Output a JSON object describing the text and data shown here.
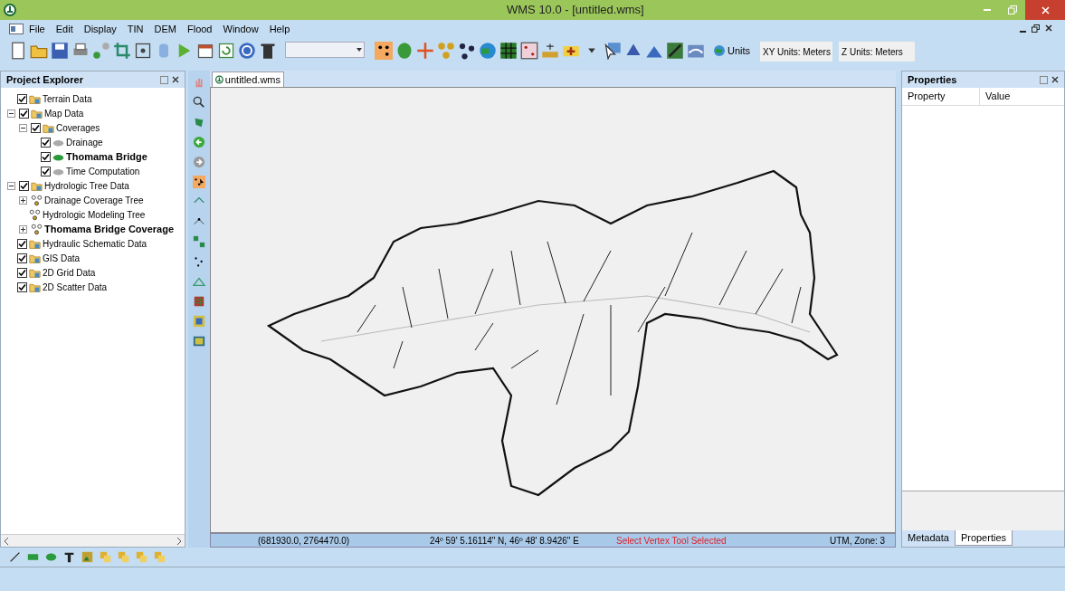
{
  "window": {
    "title": "WMS 10.0 - [untitled.wms]"
  },
  "menu": [
    "File",
    "Edit",
    "Display",
    "TIN",
    "DEM",
    "Flood",
    "Window",
    "Help"
  ],
  "units": {
    "button": "Units",
    "xy": "XY Units: Meters",
    "z": "Z Units: Meters"
  },
  "project_explorer": {
    "title": "Project Explorer",
    "items": [
      {
        "label": "Terrain Data",
        "kind": "folder",
        "checked": true,
        "active": false
      },
      {
        "label": "Map Data",
        "kind": "folder",
        "checked": true,
        "active": false,
        "expanded": true,
        "children": [
          {
            "label": "Coverages",
            "kind": "folder",
            "checked": true,
            "active": false,
            "expanded": true,
            "children": [
              {
                "label": "Drainage",
                "kind": "coverage",
                "checked": true,
                "active": false
              },
              {
                "label": "Thomama Bridge",
                "kind": "coverage",
                "checked": true,
                "active": true
              },
              {
                "label": "Time Computation",
                "kind": "coverage",
                "checked": true,
                "active": false
              }
            ]
          }
        ]
      },
      {
        "label": "Hydrologic Tree Data",
        "kind": "folder",
        "checked": true,
        "active": false,
        "expanded": true,
        "children": [
          {
            "label": "Drainage Coverage Tree",
            "kind": "tree",
            "active": false,
            "expanded": false
          },
          {
            "label": "Hydrologic Modeling Tree",
            "kind": "tree",
            "active": false
          },
          {
            "label": "Thomama Bridge Coverage",
            "kind": "tree",
            "active": true,
            "expanded": false
          }
        ]
      },
      {
        "label": "Hydraulic Schematic Data",
        "kind": "folder",
        "checked": true,
        "active": false
      },
      {
        "label": "GIS Data",
        "kind": "folder",
        "checked": true,
        "active": false
      },
      {
        "label": "2D Grid Data",
        "kind": "folder",
        "checked": true,
        "active": false
      },
      {
        "label": "2D Scatter Data",
        "kind": "folder",
        "checked": true,
        "active": false
      }
    ]
  },
  "document_tab": {
    "label": "untitled.wms"
  },
  "properties": {
    "title": "Properties",
    "columns": [
      "Property",
      "Value"
    ],
    "tabs": [
      {
        "label": "Metadata",
        "selected": false
      },
      {
        "label": "Properties",
        "selected": true
      }
    ]
  },
  "status_bar": {
    "coordinates": "(681930.0, 2764470.0)",
    "lat_long": "24º 59' 5.16114\" N, 46º 48' 8.9426\" E",
    "message": "Select Vertex Tool Selected",
    "zone": "UTM, Zone: 3"
  }
}
